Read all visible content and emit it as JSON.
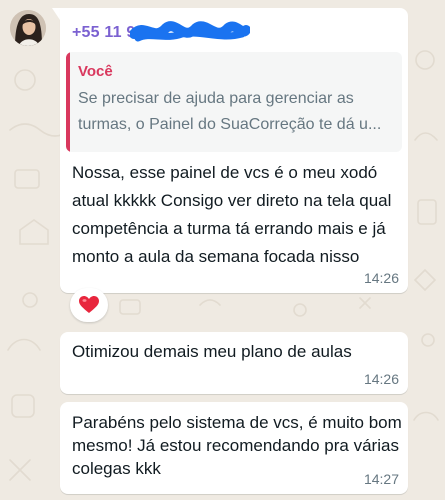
{
  "sender": {
    "phone": "+55 11 9",
    "phone_redacted": true
  },
  "messages": [
    {
      "quote": {
        "author": "Você",
        "text": "Se precisar de ajuda para gerenciar as turmas, o Painel do SuaCorreção te dá u..."
      },
      "text": "Nossa, esse painel de vcs é o meu xodó atual kkkkk Consigo ver direto na tela qual competência a turma tá errando mais e já monto a aula da semana focada nisso",
      "time": "14:26",
      "reaction": "heart-emoji"
    },
    {
      "text": "Otimizou demais meu plano de aulas",
      "time": "14:26"
    },
    {
      "text": "Parabéns pelo sistema de vcs, é muito bom mesmo! Já estou recomendando pra várias colegas kkk",
      "time": "14:27"
    }
  ],
  "colors": {
    "chat_background": "#efeae2",
    "bubble": "#ffffff",
    "sender_name": "#7b61d1",
    "quote_author": "#d9385e",
    "redaction": "#1a73f0",
    "meta_text": "#667781"
  }
}
